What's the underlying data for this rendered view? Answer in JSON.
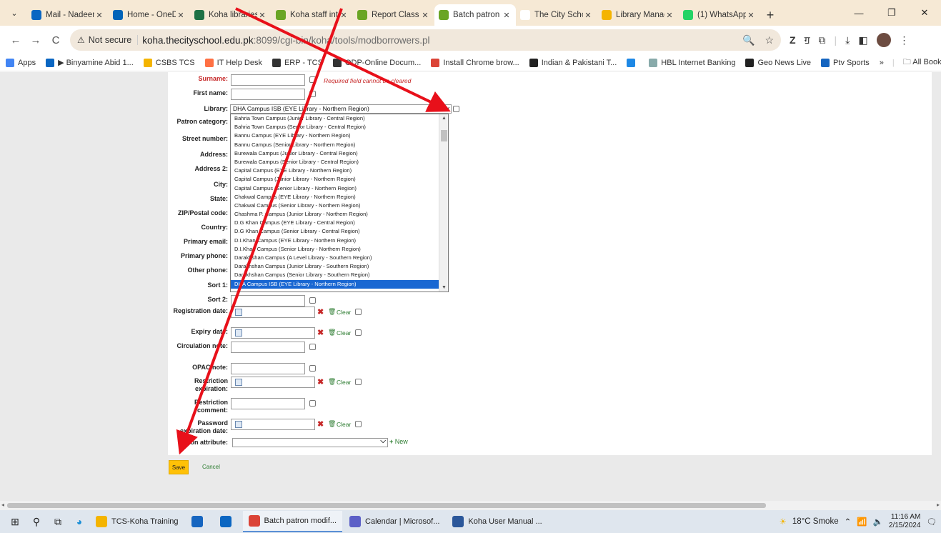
{
  "browser": {
    "tabs": [
      {
        "title": "Mail - Nadeem",
        "icon": "outlook-icon",
        "color": "#0a66c2"
      },
      {
        "title": "Home - OneDr",
        "icon": "onedrive-icon",
        "color": "#0364b8"
      },
      {
        "title": "Koha libraries",
        "icon": "excel-icon",
        "color": "#1e7145"
      },
      {
        "title": "Koha staff inte",
        "icon": "koha-icon",
        "color": "#6aa524"
      },
      {
        "title": "Report Class W",
        "icon": "koha-icon",
        "color": "#6aa524"
      },
      {
        "title": "Batch patron m",
        "icon": "koha-icon",
        "color": "#6aa524",
        "active": true
      },
      {
        "title": "The City Schoo",
        "icon": "koha-k-icon",
        "color": "#ffffff"
      },
      {
        "title": "Library Manag",
        "icon": "library-icon",
        "color": "#f4b400"
      },
      {
        "title": "(1) WhatsApp",
        "icon": "whatsapp-icon",
        "color": "#25d366"
      }
    ],
    "address": {
      "security_label": "Not secure",
      "host": "koha.thecityschool.edu.pk",
      "rest": ":8099/cgi-bin/koha/tools/modborrowers.pl"
    },
    "bookmarks": [
      {
        "label": "Apps",
        "icon": "apps-grid-icon"
      },
      {
        "label": "▶ Binyamine Abid 1...",
        "icon": "outlook-icon"
      },
      {
        "label": "CSBS TCS",
        "icon": "flower-icon"
      },
      {
        "label": "IT Help Desk",
        "icon": "helpdesk-icon"
      },
      {
        "label": "ERP - TCS",
        "icon": "globe-icon"
      },
      {
        "label": "ODP-Online Docum...",
        "icon": "globe-icon"
      },
      {
        "label": "Install Chrome brow...",
        "icon": "chrome-icon"
      },
      {
        "label": "Indian & Pakistani T...",
        "icon": "news-icon"
      },
      {
        "label": "",
        "icon": "bird-icon"
      },
      {
        "label": "HBL Internet Banking",
        "icon": "bank-icon"
      },
      {
        "label": "Geo News Live",
        "icon": "news-icon"
      },
      {
        "label": "Ptv Sports",
        "icon": "ptv-icon"
      }
    ],
    "all_bookmarks": "All Bookmarks"
  },
  "form": {
    "fields": [
      {
        "label": "Surname:",
        "label_color": "#c62828",
        "type": "text",
        "top": 0
      },
      {
        "label": "First name:",
        "type": "text"
      },
      {
        "label": "Library:",
        "type": "select"
      },
      {
        "label": "Patron category:",
        "type": "select"
      },
      {
        "label": "Street number:",
        "type": "text"
      },
      {
        "label": "Address:",
        "type": "text"
      },
      {
        "label": "Address 2:",
        "type": "text"
      },
      {
        "label": "City:",
        "type": "text"
      },
      {
        "label": "State:",
        "type": "text"
      },
      {
        "label": "ZIP/Postal code:",
        "type": "text"
      },
      {
        "label": "Country:",
        "type": "text"
      },
      {
        "label": "Primary email:",
        "type": "text"
      },
      {
        "label": "Primary phone:",
        "type": "text"
      },
      {
        "label": "Other phone:",
        "type": "text"
      },
      {
        "label": "Sort 1:",
        "type": "text"
      },
      {
        "label": "Sort 2:",
        "type": "text"
      },
      {
        "label": "Registration date:",
        "type": "date"
      },
      {
        "label": "Expiry date:",
        "type": "date"
      },
      {
        "label": "Circulation note:",
        "type": "text"
      },
      {
        "label": "OPAC note:",
        "type": "text"
      },
      {
        "label": "Restriction expiration:",
        "type": "date"
      },
      {
        "label": "Restriction comment:",
        "type": "text"
      },
      {
        "label": "Password expiration date:",
        "type": "date"
      },
      {
        "label": "Patron attribute:",
        "type": "select"
      }
    ],
    "required_note": "Required field cannot be cleared",
    "clear_label": "Clear",
    "new_label": "New",
    "library_selected": "DHA Campus ISB (EYE Library - Northern Region)",
    "library_options": [
      "Bahria Town Campus (Junior Library - Central Region)",
      "Bahria Town Campus (Senior Library - Central Region)",
      "Bannu Campus (EYE Library - Northern Region)",
      "Bannu Campus (Senior Library - Northern Region)",
      "Burewala Campus (Junior Library - Central Region)",
      "Burewala Campus (Senior Library - Central Region)",
      "Capital Campus (EYE Library - Northern Region)",
      "Capital Campus (Junior Library - Northern Region)",
      "Capital Campus (Senior Library - Northern Region)",
      "Chakwal Campus (EYE Library - Northern Region)",
      "Chakwal Campus (Senior Library - Northern Region)",
      "Chashma P. Campus (Junior Library - Northern Region)",
      "D.G Khan Campus (EYE Library - Central Region)",
      "D.G Khan Campus (Senior Library - Central Region)",
      "D.I.Khan Campus (EYE Library - Northern Region)",
      "D.I.Khan Campus (Senior Library - Northern Region)",
      "Darakhshan Campus (A Level Library - Southern Region)",
      "Darakhshan Campus (Junior Library - Southern Region)",
      "Darakhshan Campus (Senior Library - Southern Region)",
      "DHA Campus ISB (EYE Library - Northern Region)"
    ],
    "save_label": "Save",
    "cancel_label": "Cancel"
  },
  "taskbar": {
    "apps": [
      {
        "label": "TCS-Koha Training",
        "icon": "folder-icon",
        "color": "#f4b400"
      },
      {
        "label": "",
        "icon": "store-icon",
        "color": "#1565c0"
      },
      {
        "label": "",
        "icon": "mail-icon",
        "color": "#0a66c2"
      },
      {
        "label": "Batch patron modif...",
        "icon": "chrome-icon",
        "color": "#db4437",
        "running": true
      },
      {
        "label": "Calendar | Microsof...",
        "icon": "teams-icon",
        "color": "#5b5fc7"
      },
      {
        "label": "Koha User Manual ...",
        "icon": "word-icon",
        "color": "#2b579a"
      }
    ],
    "weather": "18°C  Smoke",
    "time": "11:16 AM",
    "date": "2/15/2024"
  },
  "colors": {
    "annotation_arrow": "#e8101a",
    "selected_option": "#1967d2",
    "save_button": "#ffc107"
  }
}
